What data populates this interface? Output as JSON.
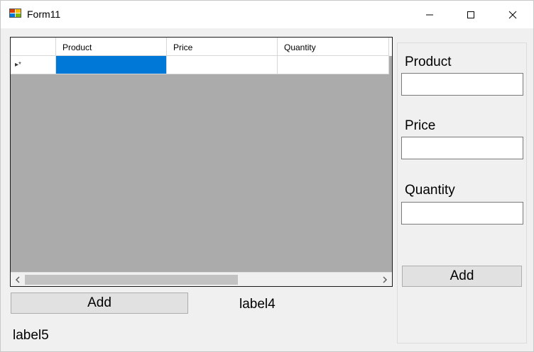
{
  "window": {
    "title": "Form11"
  },
  "grid": {
    "columns": [
      "Product",
      "Price",
      "Quantity"
    ],
    "new_row_indicator": "▸*"
  },
  "bottom": {
    "add_label": "Add",
    "label4": "label4",
    "label5": "label5"
  },
  "panel": {
    "product_label": "Product",
    "price_label": "Price",
    "quantity_label": "Quantity",
    "product_value": "",
    "price_value": "",
    "quantity_value": "",
    "add_label": "Add"
  },
  "colors": {
    "selection": "#0078d7",
    "grid_background": "#ababab"
  }
}
